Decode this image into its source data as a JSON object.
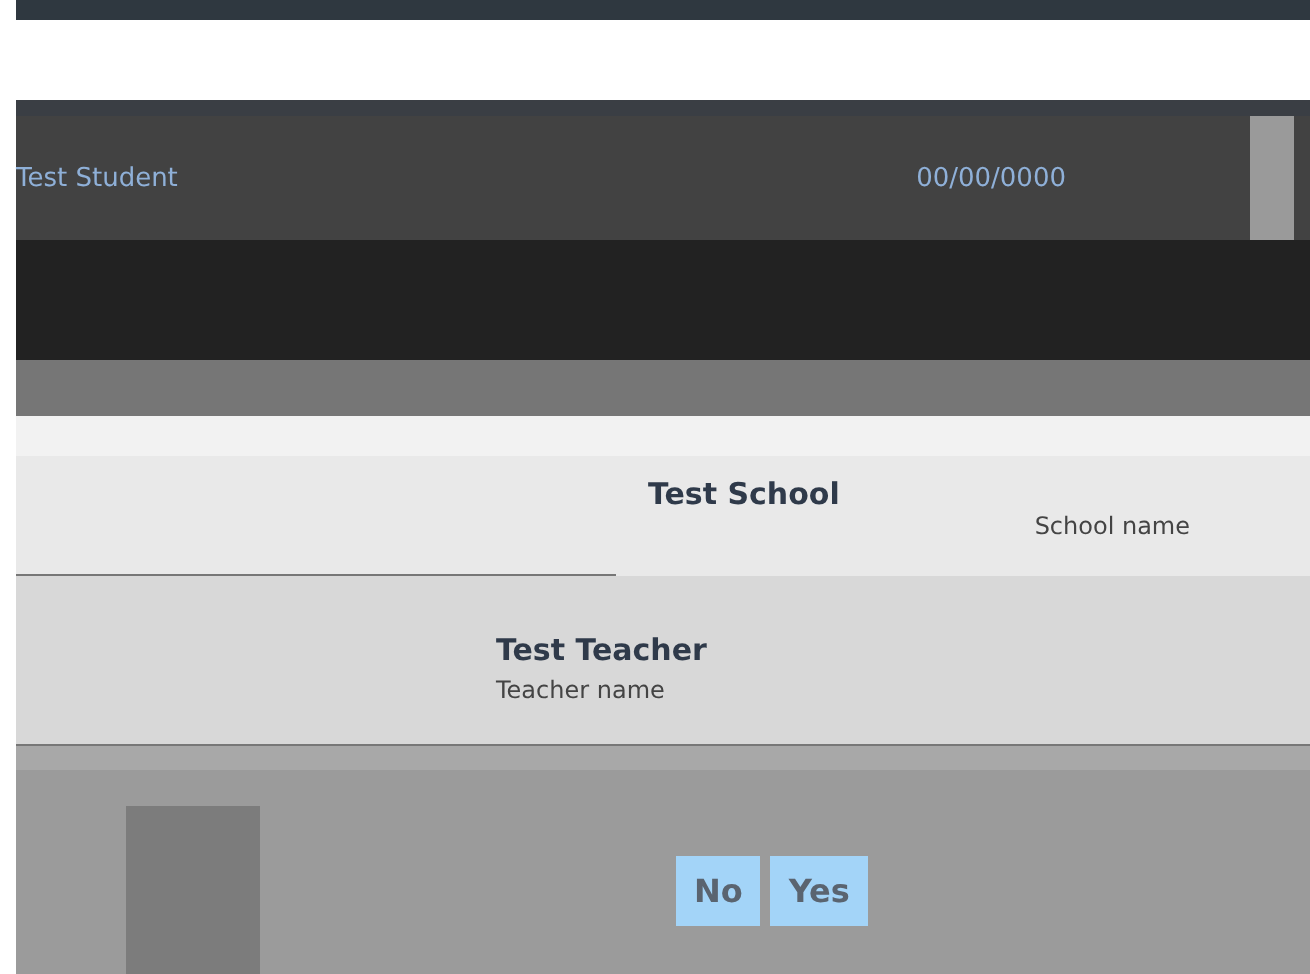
{
  "student": {
    "name": "Test Student",
    "date": "00/00/0000"
  },
  "school": {
    "value": "Test School",
    "label": "School name"
  },
  "teacher": {
    "value": "Test Teacher",
    "label": "Teacher name"
  },
  "buttons": [
    {
      "label": "No"
    },
    {
      "label": "Yes"
    }
  ]
}
